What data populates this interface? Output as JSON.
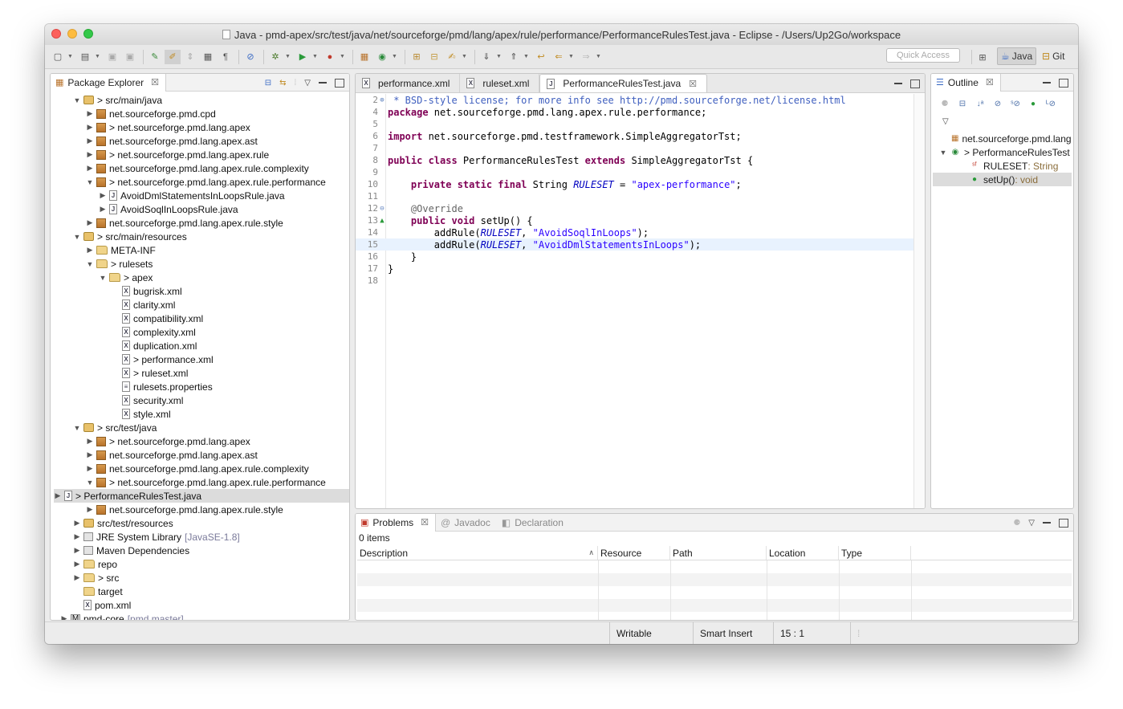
{
  "window": {
    "title": "Java - pmd-apex/src/test/java/net/sourceforge/pmd/lang/apex/rule/performance/PerformanceRulesTest.java - Eclipse - /Users/Up2Go/workspace"
  },
  "toolbar": {
    "quick_access_placeholder": "Quick Access",
    "perspectives": [
      {
        "label": "Java",
        "active": true
      },
      {
        "label": "Git",
        "active": false
      }
    ]
  },
  "package_explorer": {
    "tab_label": "Package Explorer",
    "rows": [
      {
        "indent": 1,
        "twisty": "open",
        "icon": "source-folder",
        "text": "> src/main/java"
      },
      {
        "indent": 2,
        "twisty": "closed",
        "icon": "package",
        "text": "net.sourceforge.pmd.cpd"
      },
      {
        "indent": 2,
        "twisty": "closed",
        "icon": "package",
        "text": "> net.sourceforge.pmd.lang.apex"
      },
      {
        "indent": 2,
        "twisty": "closed",
        "icon": "package",
        "text": "net.sourceforge.pmd.lang.apex.ast"
      },
      {
        "indent": 2,
        "twisty": "closed",
        "icon": "package",
        "text": "> net.sourceforge.pmd.lang.apex.rule"
      },
      {
        "indent": 2,
        "twisty": "closed",
        "icon": "package",
        "text": "net.sourceforge.pmd.lang.apex.rule.complexity"
      },
      {
        "indent": 2,
        "twisty": "open",
        "icon": "package",
        "text": "> net.sourceforge.pmd.lang.apex.rule.performance"
      },
      {
        "indent": 3,
        "twisty": "closed",
        "icon": "java-file",
        "text": "AvoidDmlStatementsInLoopsRule.java"
      },
      {
        "indent": 3,
        "twisty": "closed",
        "icon": "java-file",
        "text": "AvoidSoqlInLoopsRule.java"
      },
      {
        "indent": 2,
        "twisty": "closed",
        "icon": "package",
        "text": "net.sourceforge.pmd.lang.apex.rule.style"
      },
      {
        "indent": 1,
        "twisty": "open",
        "icon": "source-folder",
        "text": "> src/main/resources"
      },
      {
        "indent": 2,
        "twisty": "closed",
        "icon": "folder",
        "text": "META-INF"
      },
      {
        "indent": 2,
        "twisty": "open",
        "icon": "folder",
        "text": "> rulesets"
      },
      {
        "indent": 3,
        "twisty": "open",
        "icon": "folder",
        "text": "> apex"
      },
      {
        "indent": 4,
        "twisty": "none",
        "icon": "xml-file",
        "text": "bugrisk.xml"
      },
      {
        "indent": 4,
        "twisty": "none",
        "icon": "xml-file",
        "text": "clarity.xml"
      },
      {
        "indent": 4,
        "twisty": "none",
        "icon": "xml-file",
        "text": "compatibility.xml"
      },
      {
        "indent": 4,
        "twisty": "none",
        "icon": "xml-file",
        "text": "complexity.xml"
      },
      {
        "indent": 4,
        "twisty": "none",
        "icon": "xml-file",
        "text": "duplication.xml"
      },
      {
        "indent": 4,
        "twisty": "none",
        "icon": "xml-file",
        "text": "> performance.xml"
      },
      {
        "indent": 4,
        "twisty": "none",
        "icon": "xml-file",
        "text": "> ruleset.xml"
      },
      {
        "indent": 4,
        "twisty": "none",
        "icon": "text-file",
        "text": "rulesets.properties"
      },
      {
        "indent": 4,
        "twisty": "none",
        "icon": "xml-file",
        "text": "security.xml"
      },
      {
        "indent": 4,
        "twisty": "none",
        "icon": "xml-file",
        "text": "style.xml"
      },
      {
        "indent": 1,
        "twisty": "open",
        "icon": "source-folder",
        "text": "> src/test/java"
      },
      {
        "indent": 2,
        "twisty": "closed",
        "icon": "package",
        "text": "> net.sourceforge.pmd.lang.apex"
      },
      {
        "indent": 2,
        "twisty": "closed",
        "icon": "package",
        "text": "net.sourceforge.pmd.lang.apex.ast"
      },
      {
        "indent": 2,
        "twisty": "closed",
        "icon": "package",
        "text": "net.sourceforge.pmd.lang.apex.rule.complexity"
      },
      {
        "indent": 2,
        "twisty": "open",
        "icon": "package",
        "text": "> net.sourceforge.pmd.lang.apex.rule.performance"
      },
      {
        "indent": 3,
        "twisty": "closed",
        "icon": "java-file",
        "text": "> PerformanceRulesTest.java",
        "selected": true
      },
      {
        "indent": 2,
        "twisty": "closed",
        "icon": "package",
        "text": "net.sourceforge.pmd.lang.apex.rule.style"
      },
      {
        "indent": 1,
        "twisty": "closed",
        "icon": "source-folder",
        "text": "src/test/resources"
      },
      {
        "indent": 1,
        "twisty": "closed",
        "icon": "library",
        "text": "JRE System Library",
        "decoration": "[JavaSE-1.8]"
      },
      {
        "indent": 1,
        "twisty": "closed",
        "icon": "library",
        "text": "Maven Dependencies"
      },
      {
        "indent": 1,
        "twisty": "closed",
        "icon": "folder",
        "text": "repo"
      },
      {
        "indent": 1,
        "twisty": "closed",
        "icon": "folder",
        "text": "> src"
      },
      {
        "indent": 1,
        "twisty": "none",
        "icon": "folder",
        "text": "target"
      },
      {
        "indent": 1,
        "twisty": "none",
        "icon": "xml-file",
        "text": "pom.xml"
      },
      {
        "indent": 0,
        "twisty": "closed",
        "icon": "project",
        "text": "pmd-core",
        "decoration": "[pmd master]"
      }
    ]
  },
  "editor": {
    "tabs": [
      {
        "label": "performance.xml",
        "icon": "xml-file",
        "active": false
      },
      {
        "label": "ruleset.xml",
        "icon": "xml-file",
        "active": false
      },
      {
        "label": "PerformanceRulesTest.java",
        "icon": "java-file",
        "active": true
      }
    ],
    "lines": [
      {
        "n": "2",
        "marker": "⊕",
        "segments": [
          {
            "c": "cm",
            "t": " * BSD-style license; for more info see http://pmd.sourceforge.net/license.html"
          }
        ]
      },
      {
        "n": "4",
        "segments": [
          {
            "c": "kw",
            "t": "package"
          },
          {
            "c": "",
            "t": " net.sourceforge.pmd.lang.apex.rule.performance;"
          }
        ]
      },
      {
        "n": "5",
        "segments": []
      },
      {
        "n": "6",
        "segments": [
          {
            "c": "kw",
            "t": "import"
          },
          {
            "c": "",
            "t": " net.sourceforge.pmd.testframework.SimpleAggregatorTst;"
          }
        ]
      },
      {
        "n": "7",
        "segments": []
      },
      {
        "n": "8",
        "segments": [
          {
            "c": "kw",
            "t": "public class"
          },
          {
            "c": "",
            "t": " PerformanceRulesTest "
          },
          {
            "c": "kw",
            "t": "extends"
          },
          {
            "c": "",
            "t": " SimpleAggregatorTst {"
          }
        ]
      },
      {
        "n": "9",
        "segments": []
      },
      {
        "n": "10",
        "segments": [
          {
            "c": "",
            "t": "    "
          },
          {
            "c": "kw",
            "t": "private static final"
          },
          {
            "c": "",
            "t": " String "
          },
          {
            "c": "fld",
            "t": "RULESET"
          },
          {
            "c": "",
            "t": " = "
          },
          {
            "c": "str",
            "t": "\"apex-performance\""
          },
          {
            "c": "",
            "t": ";"
          }
        ]
      },
      {
        "n": "11",
        "segments": []
      },
      {
        "n": "12",
        "marker": "⊖",
        "segments": [
          {
            "c": "",
            "t": "    "
          },
          {
            "c": "ann",
            "t": "@Override"
          }
        ]
      },
      {
        "n": "13",
        "marker": "▲",
        "segments": [
          {
            "c": "",
            "t": "    "
          },
          {
            "c": "kw",
            "t": "public void"
          },
          {
            "c": "",
            "t": " setUp() {"
          }
        ]
      },
      {
        "n": "14",
        "segments": [
          {
            "c": "",
            "t": "        addRule("
          },
          {
            "c": "fld",
            "t": "RULESET"
          },
          {
            "c": "",
            "t": ", "
          },
          {
            "c": "str",
            "t": "\"AvoidSoqlInLoops\""
          },
          {
            "c": "",
            "t": ");"
          }
        ]
      },
      {
        "n": "15",
        "current": true,
        "segments": [
          {
            "c": "",
            "t": "        addRule("
          },
          {
            "c": "fld",
            "t": "RULESET"
          },
          {
            "c": "",
            "t": ", "
          },
          {
            "c": "str",
            "t": "\"AvoidDmlStatementsInLoops\""
          },
          {
            "c": "",
            "t": ");"
          }
        ]
      },
      {
        "n": "16",
        "segments": [
          {
            "c": "",
            "t": "    }"
          }
        ]
      },
      {
        "n": "17",
        "segments": [
          {
            "c": "",
            "t": "}"
          }
        ]
      },
      {
        "n": "18",
        "segments": []
      }
    ]
  },
  "outline": {
    "tab_label": "Outline",
    "rows": [
      {
        "indent": 1,
        "icon": "package",
        "text": "net.sourceforge.pmd.lang.apex.rule.performance",
        "twisty": "none"
      },
      {
        "indent": 0,
        "icon": "class",
        "text": "> PerformanceRulesTest",
        "twisty": "open"
      },
      {
        "indent": 2,
        "icon": "static-field",
        "text": "RULESET",
        "suffix": " : String",
        "twisty": "none"
      },
      {
        "indent": 2,
        "icon": "method",
        "text": "setUp()",
        "suffix": " : void",
        "twisty": "none",
        "selected": true
      }
    ]
  },
  "bottom_panel": {
    "tabs": [
      {
        "label": "Problems",
        "active": true
      },
      {
        "label": "Javadoc",
        "active": false
      },
      {
        "label": "Declaration",
        "active": false
      }
    ],
    "count_text": "0 items",
    "columns": [
      "Description",
      "Resource",
      "Path",
      "Location",
      "Type"
    ]
  },
  "statusbar": {
    "writable": "Writable",
    "insert_mode": "Smart Insert",
    "position": "15 : 1"
  },
  "colors": {
    "keyword": "#7f0055",
    "string": "#2a00ff",
    "comment": "#3f5fbf",
    "field": "#0000c0",
    "current_line": "#e8f2fe"
  }
}
